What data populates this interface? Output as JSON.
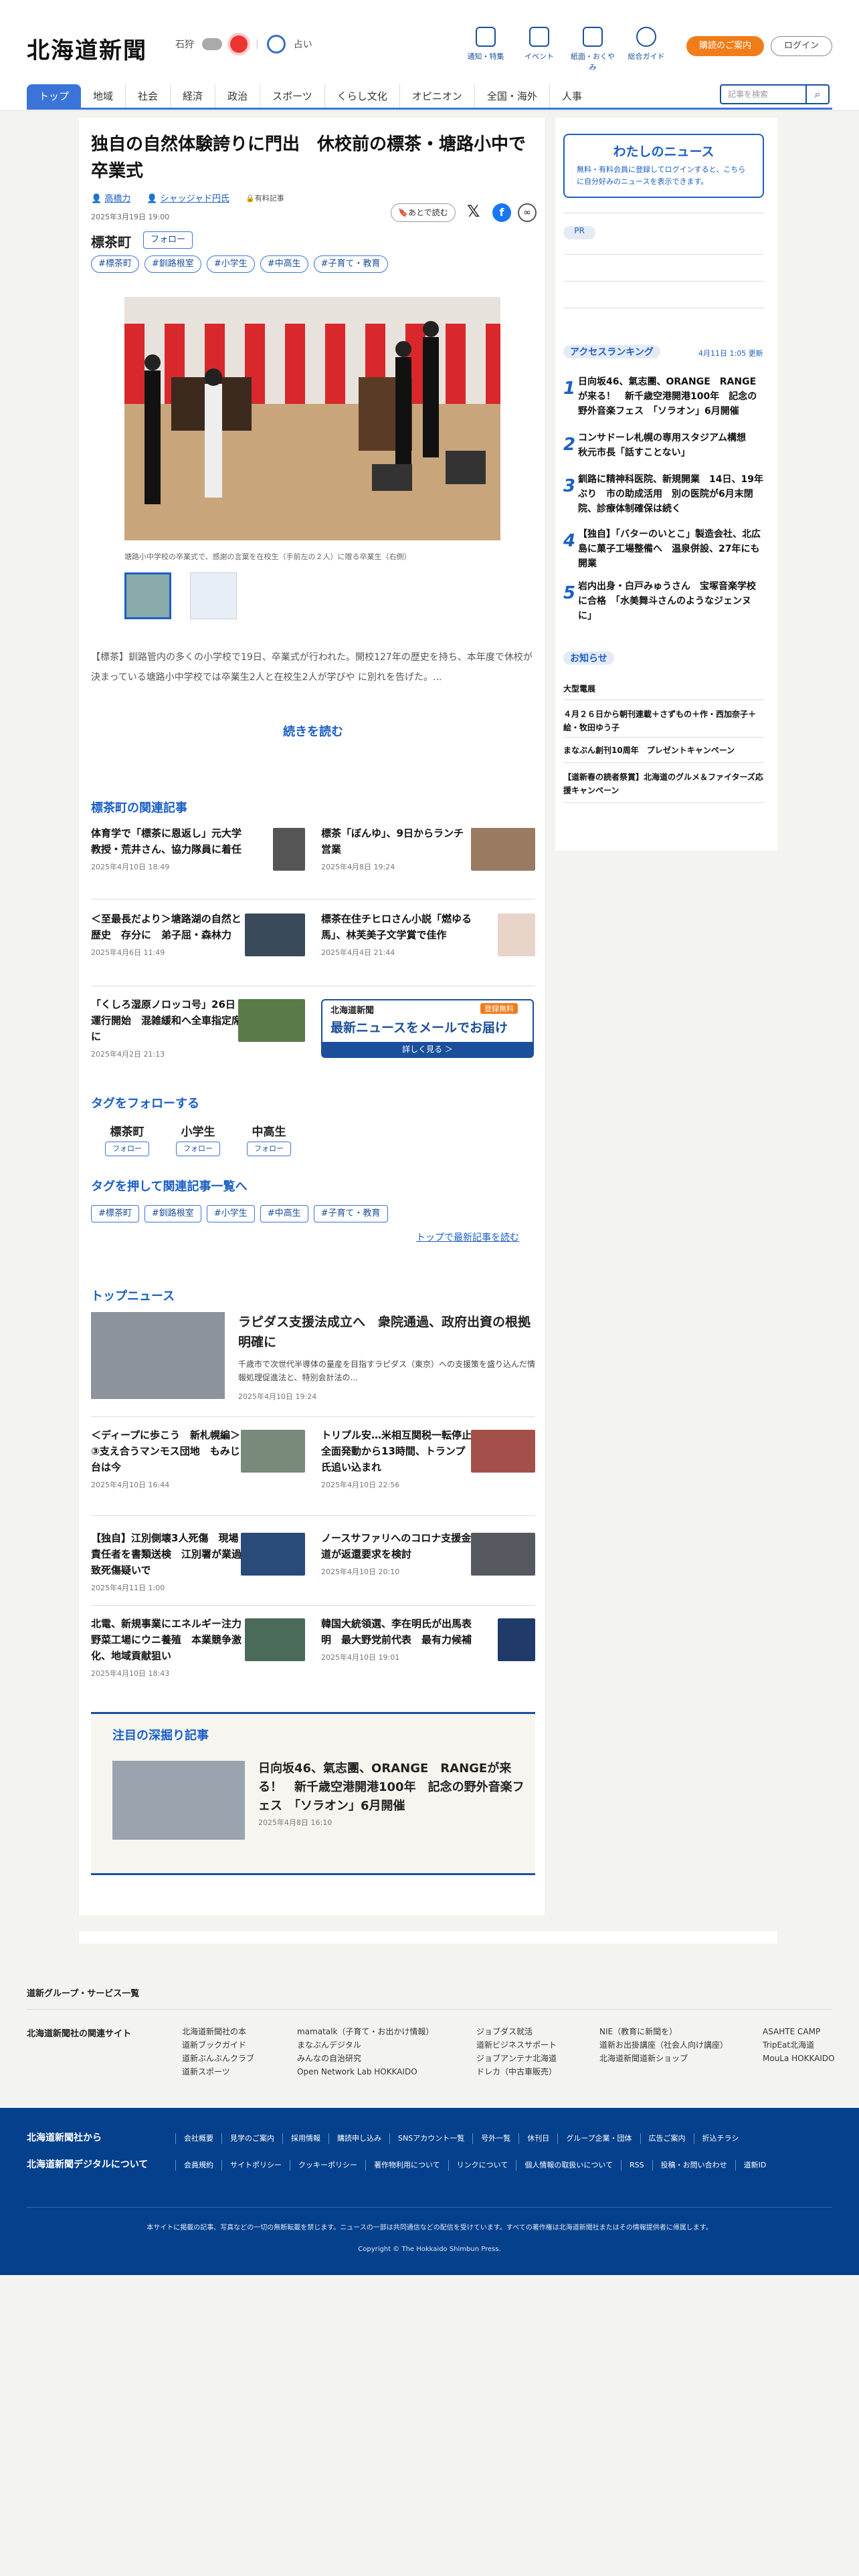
{
  "header": {
    "logo": "北海道新聞",
    "region": "石狩",
    "fortune": "占い",
    "nav": [
      "通知・特集",
      "イベント",
      "紙面・おくやみ",
      "総合ガイド"
    ],
    "subscribe": "購読のご案内",
    "login": "ログイン",
    "tabs": [
      "トップ",
      "地域",
      "社会",
      "経済",
      "政治",
      "スポーツ",
      "くらし文化",
      "オピニオン",
      "全国・海外",
      "人事"
    ],
    "search_placeholder": "記事を検索"
  },
  "article": {
    "title": "独自の自然体験誇りに門出　休校前の標茶・塘路小中で卒業式",
    "author1": "高橋力",
    "author2": "シャッジャド円氏",
    "badge": "有料記事",
    "date": "2025年3月19日 19:00",
    "save": "あとで読む",
    "topic": "標茶町",
    "follow": "フォロー",
    "tags": [
      "#標茶町",
      "#釧路根室",
      "#小学生",
      "#中高生",
      "#子育て・教育"
    ],
    "caption": "塘路小中学校の卒業式で、感謝の言葉を在校生（手前左の２人）に贈る卒業生（右側）",
    "lead": "【標茶】釧路管内の多くの小学校で19日、卒業式が行われた。開校127年の歴史を持ち、本年度で休校が決まっている塘路小中学校では卒業生2人と在校生2人が学びや に別れを告げた。...",
    "readmore": "続きを読む"
  },
  "related": {
    "title": "標茶町の関連記事",
    "items": [
      {
        "t": "体育学で「標茶に恩返し」元大学教授・荒井さん、協力隊員に着任",
        "d": "2025年4月10日 18:49"
      },
      {
        "t": "標茶「ぼんゆ」、9日からランチ営業",
        "d": "2025年4月8日 19:24"
      },
      {
        "t": "＜至最長だより＞塘路湖の自然と歴史　存分に　弟子屈・森林力",
        "d": "2025年4月6日 11:49"
      },
      {
        "t": "標茶在住チヒロさん小説「燃ゆる馬」、林芙美子文学賞で佳作",
        "d": "2025年4月4日 21:44"
      },
      {
        "t": "「くしろ湿原ノロッコ号」26日運行開始　混雑緩和へ全車指定席に",
        "d": "2025年4月2日 21:13"
      }
    ]
  },
  "promo": {
    "brand": "北海道新聞",
    "badge": "登録無料",
    "main": "最新ニュースをメールでお届け",
    "sub": "詳しく見る ＞"
  },
  "follow_tags": {
    "title": "タグをフォローする",
    "items": [
      "標茶町",
      "小学生",
      "中高生"
    ],
    "btn": "フォロー"
  },
  "push_tags": {
    "title": "タグを押して関連記事一覧へ",
    "latest": "トップで最新記事を読む"
  },
  "topnews": {
    "title": "トップニュース",
    "lead_t": "ラピダス支援法成立へ　衆院通過、政府出資の根拠明確に",
    "lead_s": "千歳市で次世代半導体の量産を目指すラピダス（東京）への支援策を盛り込んだ情報処理促進法と、特別会計法の...",
    "lead_d": "2025年4月10日 19:24",
    "items": [
      {
        "t": "＜ディープに歩こう　新札幌編＞③支え合うマンモス団地　もみじ台は今",
        "d": "2025年4月10日 16:44"
      },
      {
        "t": "トリプル安…米相互関税一転停止　全面発動から13時間、トランプ氏追い込まれ",
        "d": "2025年4月10日 22:56"
      },
      {
        "t": "【独自】江別側壊3人死傷　現場責任者を書類送検　江別署が業過致死傷疑いで",
        "d": "2025年4月11日 1:00"
      },
      {
        "t": "ノースサファリへのコロナ支援金　道が返還要求を検討",
        "d": "2025年4月10日 20:10"
      },
      {
        "t": "北電、新規事業にエネルギー注力　野菜工場にウニ養殖　本業競争激化、地域貢献狙い",
        "d": "2025年4月10日 18:43"
      },
      {
        "t": "韓国大統領選、李在明氏が出馬表明　最大野党前代表　最有力候補",
        "d": "2025年4月10日 19:01"
      }
    ]
  },
  "deep": {
    "title": "注目の深掘り記事",
    "t": "日向坂46、氣志團、ORANGE　RANGEが来る！　新千歳空港開港100年　記念の野外音楽フェス　「ソラオン」6月開催",
    "d": "2025年4月8日 16:10"
  },
  "sidebar": {
    "mynews_title": "わたしのニュース",
    "mynews_desc": "無料・有料会員に登録してログインすると、こちらに自分好みのニュースを表示できます。",
    "pr": "PR",
    "ranking_title": "アクセスランキング",
    "ranking_time": "4月11日 1:05 更新",
    "ranking": [
      {
        "n": "1",
        "t": "日向坂46、氣志團、ORANGE　RANGEが来る！　新千歳空港開港100年　記念の野外音楽フェス　「ソラオン」6月開催"
      },
      {
        "n": "2",
        "t": "コンサドーレ札幌の専用スタジアム構想　秋元市長「話すことない」"
      },
      {
        "n": "3",
        "t": "釧路に精神科医院、新規開業　14日、19年ぶり　市の助成活用　別の医院が6月末閉院、診療体制確保は続く"
      },
      {
        "n": "4",
        "t": "【独自】「バターのいとこ」製造会社、北広島に菓子工場整備へ　温泉併設、27年にも開業"
      },
      {
        "n": "5",
        "t": "岩内出身・白戸みゅうさん　宝塚音楽学校に合格　「水美舞斗さんのようなジェンヌに」"
      }
    ],
    "notice_title": "お知らせ",
    "notices": [
      "大型電展",
      "４月２６日から朝刊連載＋さずもの＋作・西加奈子＋絵・牧田ゆう子",
      "まなぶん創刊10周年　プレゼントキャンペーン",
      "【道新春の読者祭賞】北海道のグルメ＆ファイターズ応援キャンペーン"
    ]
  },
  "footer": {
    "group": "道新グループ・サービス一覧",
    "related_title": "北海道新聞社の関連サイト",
    "cols": [
      [
        "北海道新聞社の本",
        "道新ブックガイド",
        "道新ぶんぶんクラブ",
        "道新スポーツ"
      ],
      [
        "mamatalk（子育て・お出かけ情報）",
        "まなぶんデジタル",
        "みんなの自治研究",
        "Open Network Lab HOKKAIDO"
      ],
      [
        "ジョブダス就活",
        "道新ビジネスサポート",
        "ジョブアンテナ北海道",
        "ドレカ（中古車販売）"
      ],
      [
        "NIE（教育に新聞を）",
        "道新お出掛講座（社会人向け講座）",
        "北海道新聞道新ショップ"
      ],
      [
        "ASAHTE CAMP",
        "TripEat北海道",
        "MouLa HOKKAIDO"
      ]
    ],
    "about1": "北海道新聞社から",
    "about2": "北海道新聞デジタルについて",
    "links1": [
      "会社概要",
      "見学のご案内",
      "採用情報",
      "購読申し込み",
      "SNSアカウント一覧",
      "号外一覧",
      "休刊日",
      "グループ企業・団体",
      "広告ご案内",
      "折込チラシ"
    ],
    "links2": [
      "会員規約",
      "サイトポリシー",
      "クッキーポリシー",
      "著作物利用について",
      "リンクについて",
      "個人情報の取扱いについて",
      "RSS",
      "投稿・お問い合わせ",
      "道新ID"
    ],
    "notice": "本サイトに掲載の記事、写真などの一切の無断転載を禁じます。ニュースの一部は共同通信などの配信を受けています。すべての著作権は北海道新聞社またはその情報提供者に帰属します。",
    "copyright": "Copyright © The Hokkaido Shimbun Press."
  },
  "colors": {
    "brand": "#1b5fc4",
    "footer": "#04408c",
    "subscribe": "#f07d1a"
  }
}
